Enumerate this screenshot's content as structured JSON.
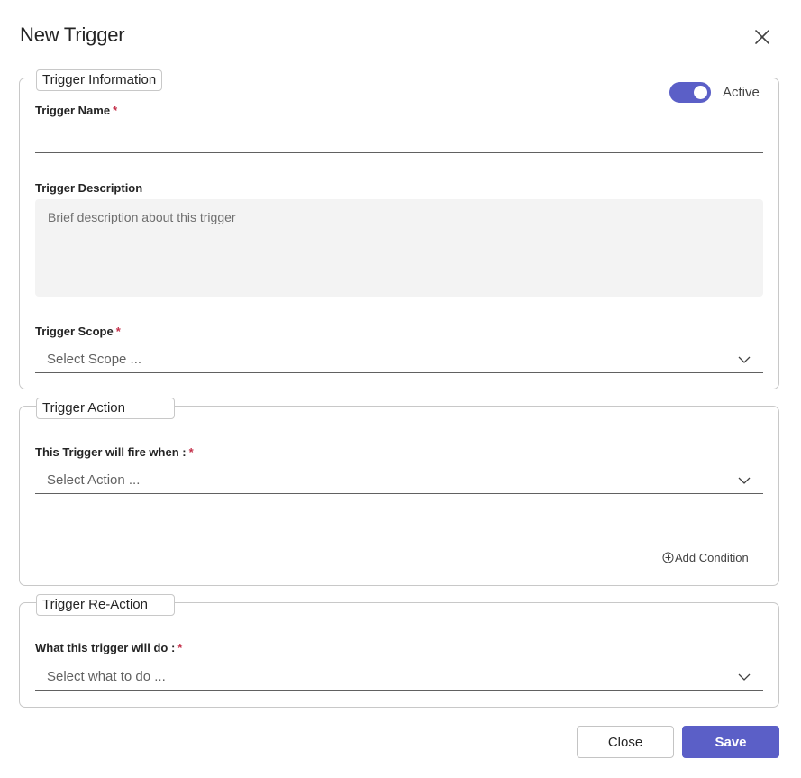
{
  "dialog": {
    "title": "New Trigger",
    "close_icon": "close-icon"
  },
  "trigger_information": {
    "legend": "Trigger Information",
    "active_toggle": {
      "label": "Active",
      "on": true,
      "color": "#5b5fc7"
    },
    "name": {
      "label": "Trigger Name",
      "required_mark": "*",
      "value": ""
    },
    "description": {
      "label": "Trigger Description",
      "placeholder": "Brief description about this trigger"
    },
    "scope": {
      "label": "Trigger Scope",
      "required_mark": "*",
      "placeholder": "Select Scope ..."
    }
  },
  "trigger_action": {
    "legend": "Trigger Action",
    "fire_when": {
      "label": "This Trigger will fire when :",
      "required_mark": "*",
      "placeholder": "Select Action ..."
    },
    "add_condition": {
      "label": "Add Condition",
      "icon": "plus-circle-icon"
    }
  },
  "trigger_reaction": {
    "legend": "Trigger Re-Action",
    "will_do": {
      "label": "What this trigger will do :",
      "required_mark": "*",
      "placeholder": "Select what to do ..."
    }
  },
  "footer": {
    "close_label": "Close",
    "save_label": "Save"
  },
  "colors": {
    "accent": "#5b5fc7",
    "required": "#c4314b",
    "border": "#c8c8c8"
  }
}
